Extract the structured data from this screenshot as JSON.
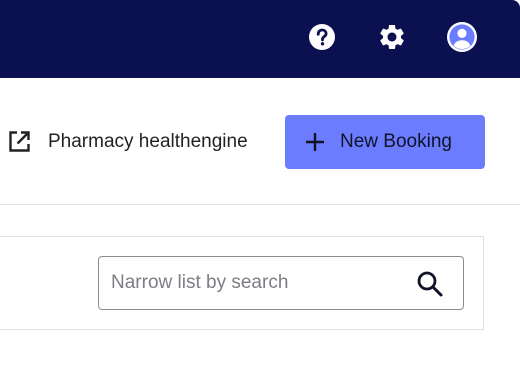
{
  "topbar": {
    "background_color": "#0b1150",
    "icons": [
      {
        "name": "help-icon"
      },
      {
        "name": "gear-icon"
      },
      {
        "name": "account-icon"
      }
    ]
  },
  "header": {
    "external_link": {
      "icon": "external-link-icon",
      "label": "Pharmacy healthengine"
    },
    "new_booking": {
      "icon": "plus-icon",
      "label": "New Booking",
      "color": "#6b7cff"
    }
  },
  "search": {
    "value": "",
    "placeholder": "Narrow list by search",
    "icon": "search-icon"
  }
}
